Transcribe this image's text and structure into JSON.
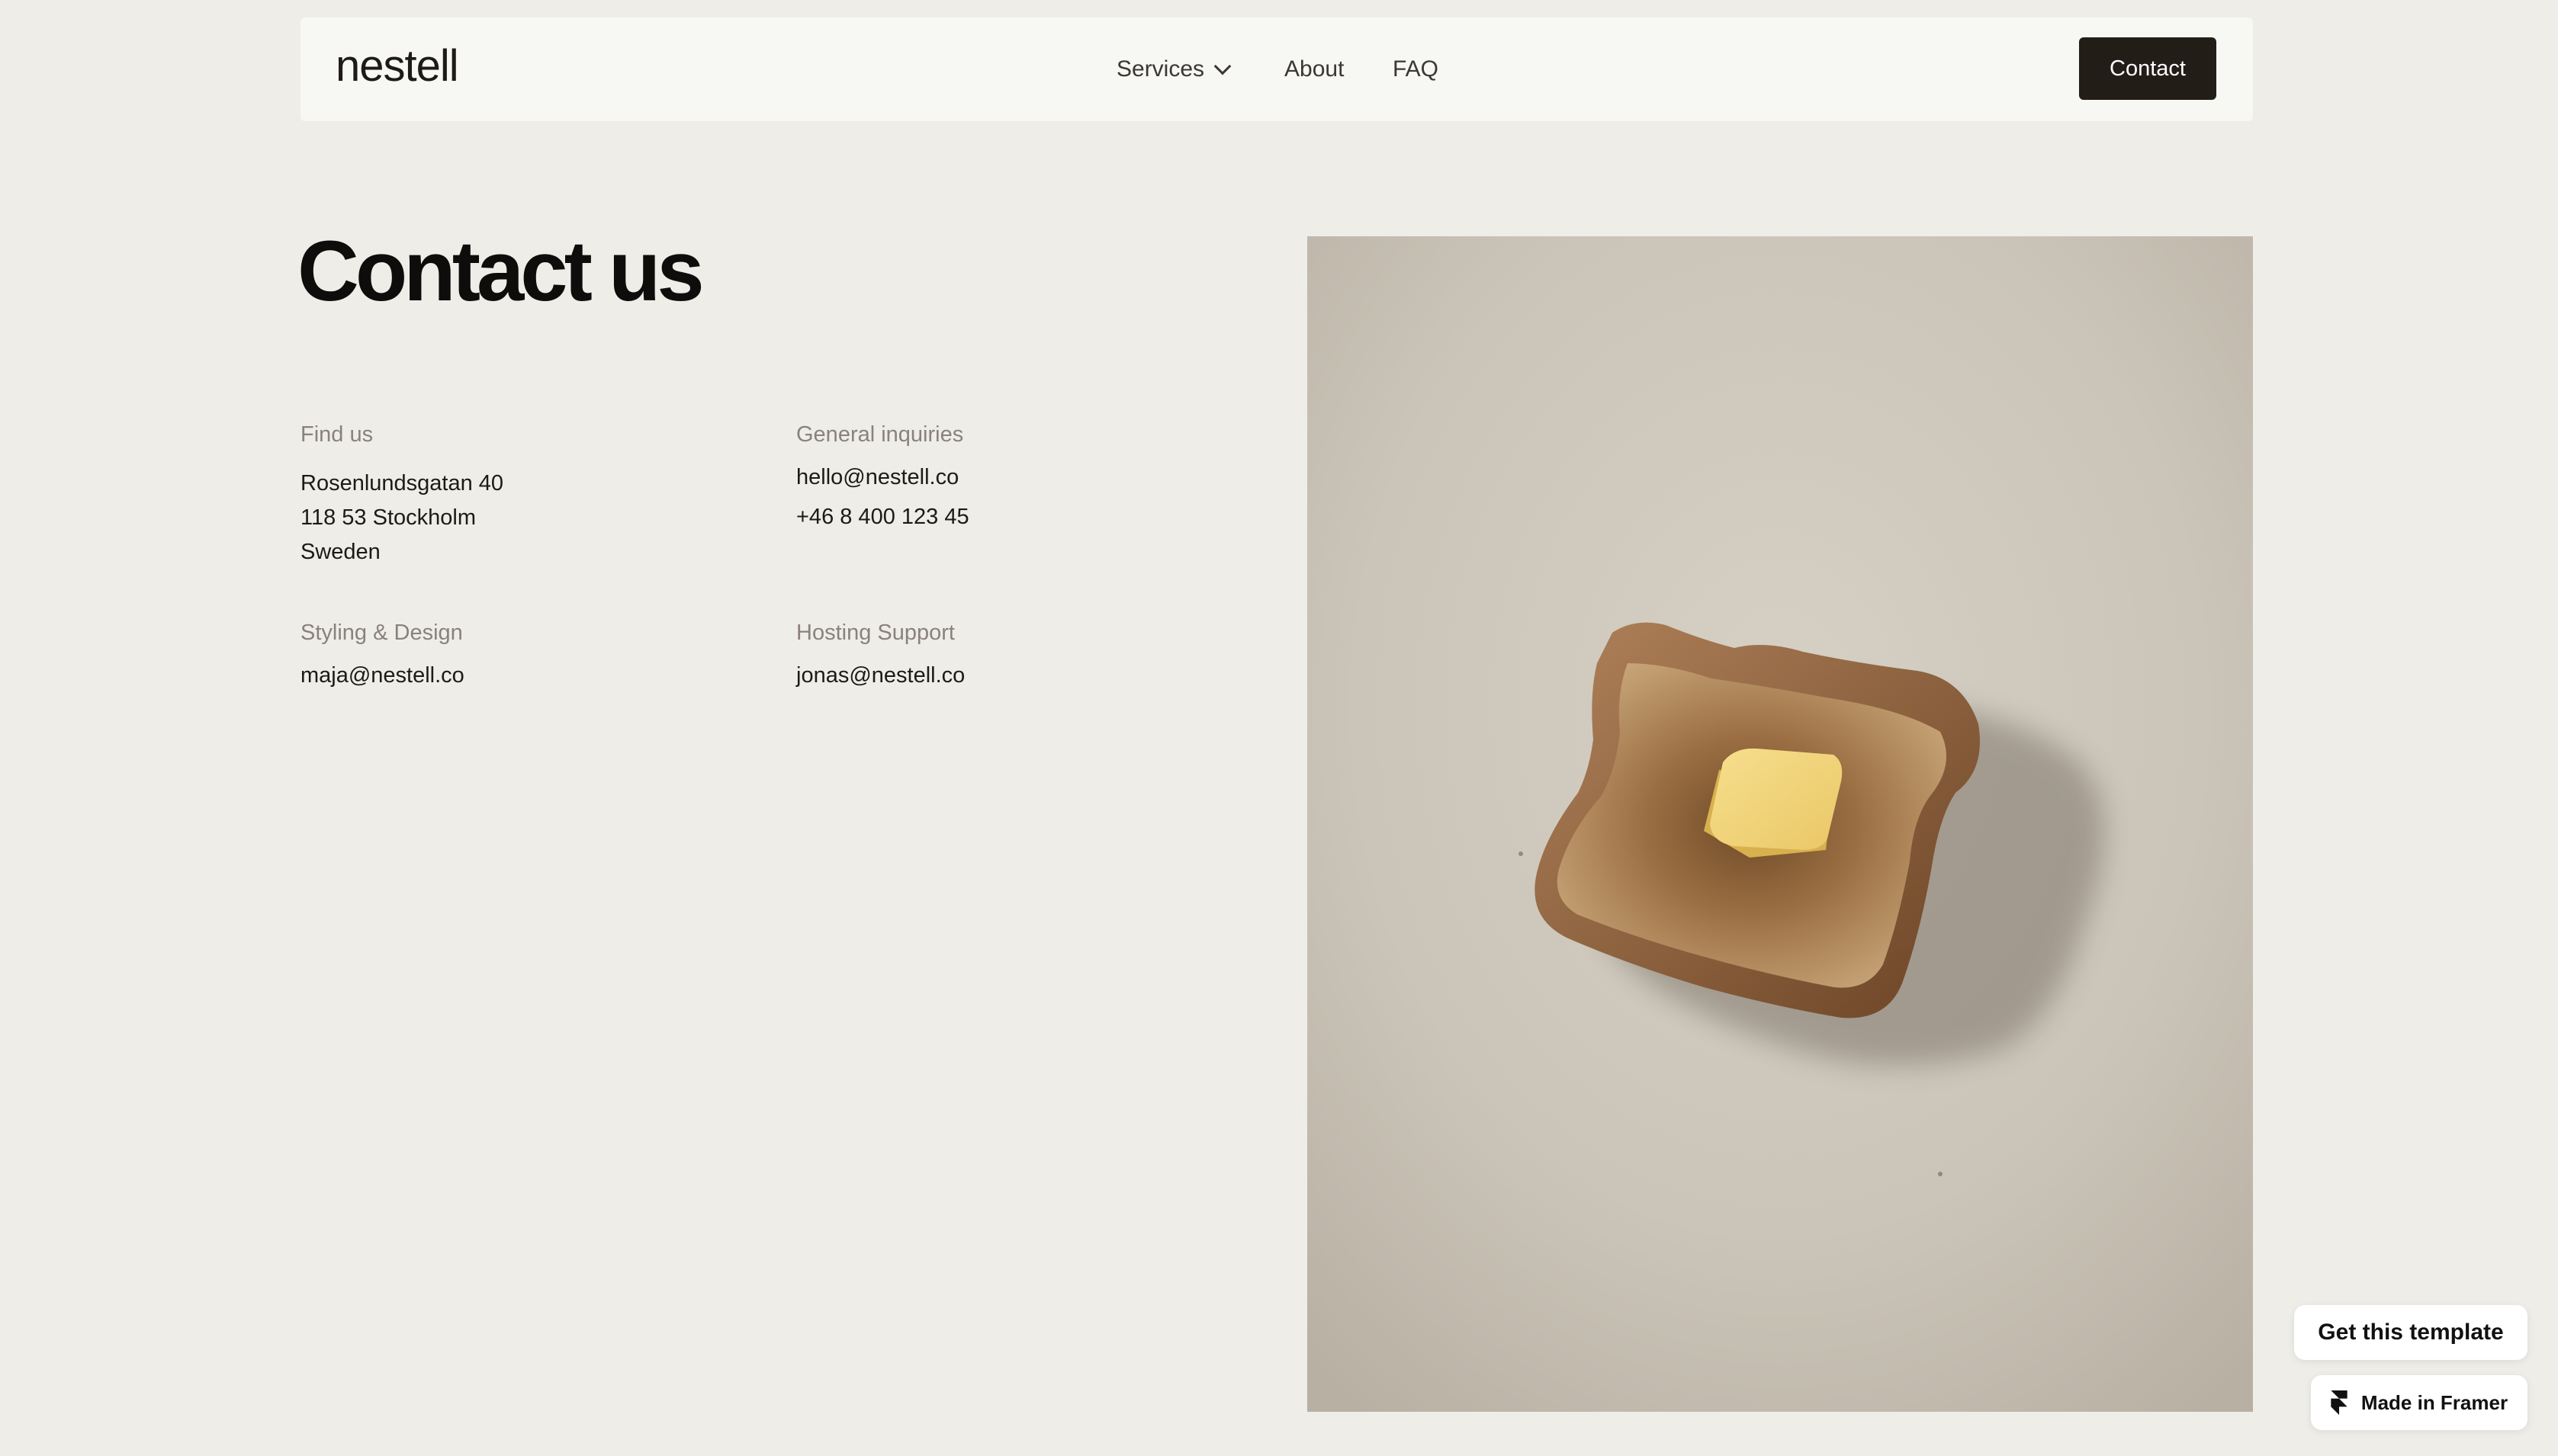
{
  "header": {
    "logo": "nestell",
    "nav": [
      {
        "label": "Services"
      },
      {
        "label": "About"
      },
      {
        "label": "FAQ"
      }
    ],
    "contact_button": "Contact"
  },
  "main": {
    "title": "Contact us",
    "blocks": {
      "find_us": {
        "label": "Find us",
        "lines": [
          "Rosenlundsgatan 40",
          "118 53 Stockholm",
          "Sweden"
        ]
      },
      "general": {
        "label": "General inquiries",
        "lines": [
          "hello@nestell.co",
          "+46 8 400 123 45"
        ]
      },
      "styling": {
        "label": "Styling & Design",
        "lines": [
          "maja@nestell.co"
        ]
      },
      "hosting": {
        "label": "Hosting Support",
        "lines": [
          "jonas@nestell.co"
        ]
      }
    }
  },
  "badges": {
    "template": "Get this template",
    "framer": "Made in Framer"
  },
  "colors": {
    "page_bg": "#eeede8",
    "header_bg": "#f7f7f4",
    "button_bg": "#231d18",
    "label": "#8a827a",
    "text": "#1d1a17"
  }
}
